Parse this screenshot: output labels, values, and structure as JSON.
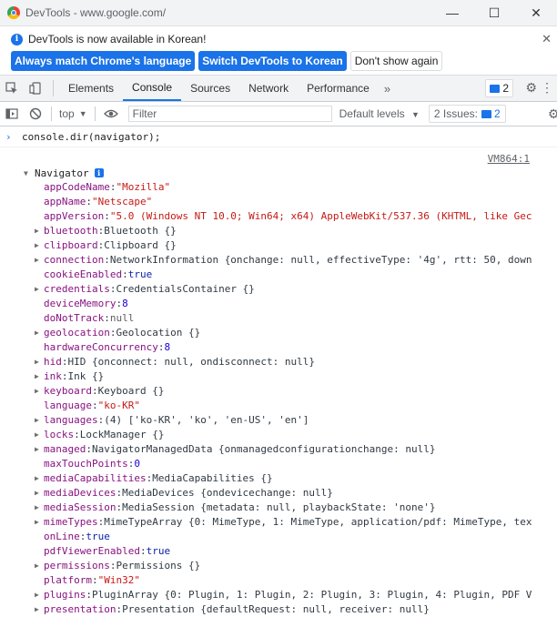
{
  "window": {
    "title": "DevTools - www.google.com/",
    "minimize": "—",
    "maximize": "☐",
    "close": "✕"
  },
  "infobar": {
    "message": "DevTools is now available in Korean!",
    "btn_match": "Always match Chrome's language",
    "btn_switch": "Switch DevTools to Korean",
    "btn_dont_show": "Don't show again",
    "close": "✕"
  },
  "tabs": {
    "items": [
      "Elements",
      "Console",
      "Sources",
      "Network",
      "Performance"
    ],
    "active": "Console",
    "more": "»",
    "issues_count": "2"
  },
  "toolbar": {
    "context": "top",
    "filter_placeholder": "Filter",
    "levels": "Default levels",
    "issues_label": "2 Issues:",
    "issues_count": "2"
  },
  "console": {
    "command": "console.dir(navigator);",
    "source_link": "VM864:1",
    "root_label": "Navigator",
    "properties": [
      {
        "key": "appCodeName",
        "value": "\"Mozilla\"",
        "type": "str",
        "expandable": false
      },
      {
        "key": "appName",
        "value": "\"Netscape\"",
        "type": "str",
        "expandable": false
      },
      {
        "key": "appVersion",
        "value": "\"5.0 (Windows NT 10.0; Win64; x64) AppleWebKit/537.36 (KHTML, like Gec",
        "type": "str",
        "expandable": false
      },
      {
        "key": "bluetooth",
        "value": "Bluetooth {}",
        "type": "obj",
        "expandable": true
      },
      {
        "key": "clipboard",
        "value": "Clipboard {}",
        "type": "obj",
        "expandable": true
      },
      {
        "key": "connection",
        "value": "NetworkInformation {onchange: null, effectiveType: '4g', rtt: 50, down",
        "type": "obj",
        "expandable": true
      },
      {
        "key": "cookieEnabled",
        "value": "true",
        "type": "kw",
        "expandable": false
      },
      {
        "key": "credentials",
        "value": "CredentialsContainer {}",
        "type": "obj",
        "expandable": true
      },
      {
        "key": "deviceMemory",
        "value": "8",
        "type": "num",
        "expandable": false
      },
      {
        "key": "doNotTrack",
        "value": "null",
        "type": "nul",
        "expandable": false
      },
      {
        "key": "geolocation",
        "value": "Geolocation {}",
        "type": "obj",
        "expandable": true
      },
      {
        "key": "hardwareConcurrency",
        "value": "8",
        "type": "num",
        "expandable": false
      },
      {
        "key": "hid",
        "value": "HID {onconnect: null, ondisconnect: null}",
        "type": "obj",
        "expandable": true
      },
      {
        "key": "ink",
        "value": "Ink {}",
        "type": "obj",
        "expandable": true
      },
      {
        "key": "keyboard",
        "value": "Keyboard {}",
        "type": "obj",
        "expandable": true
      },
      {
        "key": "language",
        "value": "\"ko-KR\"",
        "type": "str",
        "expandable": false
      },
      {
        "key": "languages",
        "value": "(4) ['ko-KR', 'ko', 'en-US', 'en']",
        "type": "obj",
        "expandable": true
      },
      {
        "key": "locks",
        "value": "LockManager {}",
        "type": "obj",
        "expandable": true
      },
      {
        "key": "managed",
        "value": "NavigatorManagedData {onmanagedconfigurationchange: null}",
        "type": "obj",
        "expandable": true
      },
      {
        "key": "maxTouchPoints",
        "value": "0",
        "type": "num",
        "expandable": false
      },
      {
        "key": "mediaCapabilities",
        "value": "MediaCapabilities {}",
        "type": "obj",
        "expandable": true
      },
      {
        "key": "mediaDevices",
        "value": "MediaDevices {ondevicechange: null}",
        "type": "obj",
        "expandable": true
      },
      {
        "key": "mediaSession",
        "value": "MediaSession {metadata: null, playbackState: 'none'}",
        "type": "obj",
        "expandable": true
      },
      {
        "key": "mimeTypes",
        "value": "MimeTypeArray {0: MimeType, 1: MimeType, application/pdf: MimeType, tex",
        "type": "obj",
        "expandable": true
      },
      {
        "key": "onLine",
        "value": "true",
        "type": "kw",
        "expandable": false
      },
      {
        "key": "pdfViewerEnabled",
        "value": "true",
        "type": "kw",
        "expandable": false
      },
      {
        "key": "permissions",
        "value": "Permissions {}",
        "type": "obj",
        "expandable": true
      },
      {
        "key": "platform",
        "value": "\"Win32\"",
        "type": "str",
        "expandable": false
      },
      {
        "key": "plugins",
        "value": "PluginArray {0: Plugin, 1: Plugin, 2: Plugin, 3: Plugin, 4: Plugin, PDF V",
        "type": "obj",
        "expandable": true
      },
      {
        "key": "presentation",
        "value": "Presentation {defaultRequest: null, receiver: null}",
        "type": "obj",
        "expandable": true
      }
    ]
  }
}
